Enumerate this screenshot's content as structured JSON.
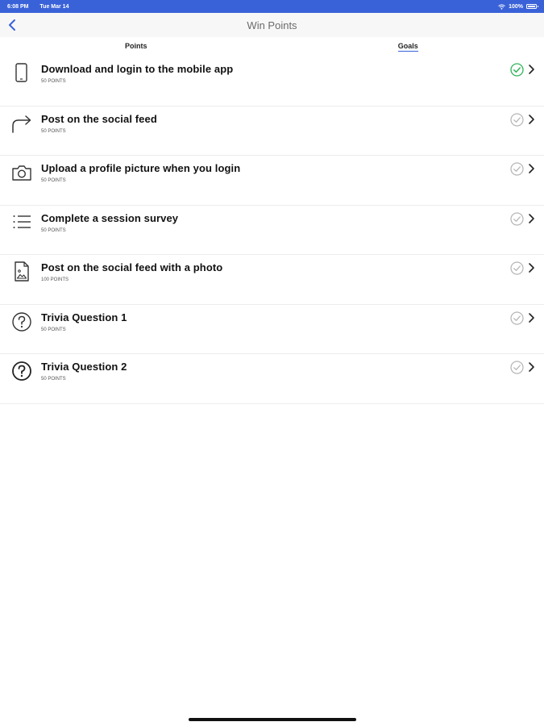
{
  "status_bar": {
    "time": "6:08 PM",
    "date": "Tue Mar 14",
    "battery": "100%"
  },
  "nav": {
    "title": "Win Points"
  },
  "tabs": [
    {
      "label": "Points",
      "active": false
    },
    {
      "label": "Goals",
      "active": true
    }
  ],
  "goals": [
    {
      "title": "Download and login to the mobile app",
      "points": "50 POINTS",
      "icon": "phone-icon",
      "completed": true
    },
    {
      "title": "Post on the social feed",
      "points": "50 POINTS",
      "icon": "share-arrow-icon",
      "completed": false
    },
    {
      "title": "Upload a profile picture when you login",
      "points": "50 POINTS",
      "icon": "camera-icon",
      "completed": false
    },
    {
      "title": "Complete a session survey",
      "points": "50 POINTS",
      "icon": "list-icon",
      "completed": false
    },
    {
      "title": "Post on the social feed with a photo",
      "points": "100 POINTS",
      "icon": "image-file-icon",
      "completed": false
    },
    {
      "title": "Trivia Question 1",
      "points": "50 POINTS",
      "icon": "question-icon",
      "completed": false
    },
    {
      "title": "Trivia Question 2",
      "points": "50 POINTS",
      "icon": "question-icon",
      "completed": false
    }
  ],
  "colors": {
    "accent": "#3a62d8",
    "complete": "#2fb45a",
    "incomplete": "#b5b5b5"
  }
}
